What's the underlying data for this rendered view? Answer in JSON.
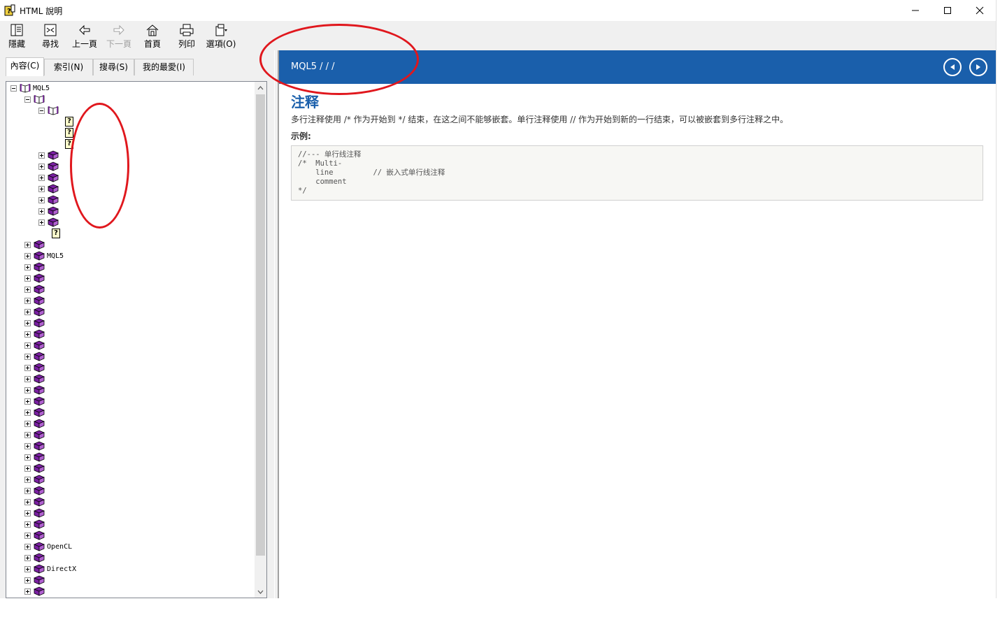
{
  "window": {
    "title": "HTML 說明"
  },
  "toolbar": {
    "buttons": [
      {
        "label": "隱藏",
        "icon": "hide-icon"
      },
      {
        "label": "尋找",
        "icon": "locate-icon"
      },
      {
        "label": "上一頁",
        "icon": "back-arrow-icon"
      },
      {
        "label": "下一頁",
        "icon": "forward-arrow-icon"
      },
      {
        "label": "首頁",
        "icon": "home-icon"
      },
      {
        "label": "列印",
        "icon": "print-icon"
      },
      {
        "label": "選項(O)",
        "icon": "options-icon"
      }
    ]
  },
  "nav": {
    "tabs": [
      {
        "label": "內容(C)"
      },
      {
        "label": "索引(N)"
      },
      {
        "label": "搜尋(S)"
      },
      {
        "label": "我的最愛(I)"
      }
    ],
    "tree": {
      "root_label": "MQL5",
      "labels": {
        "mql5": "MQL5",
        "opencl": "OpenCL",
        "directx": "DirectX"
      }
    }
  },
  "content": {
    "breadcrumb": "MQL5 /   /   /",
    "title": "注释",
    "description": "多行注释使用 /* 作为开始到 */ 结束，在这之间不能够嵌套。单行注释使用 // 作为开始到新的一行结束，可以被嵌套到多行注释之中。",
    "example_label": "示例:",
    "code": "//--- 单行线注释\n/*  Multi-\n    line         // 嵌入式单行线注释\n    comment\n*/"
  },
  "colors": {
    "banner": "#1a5fab",
    "title": "#1a5fab",
    "annotation": "#e0171d",
    "book": "#7a1fa2"
  }
}
